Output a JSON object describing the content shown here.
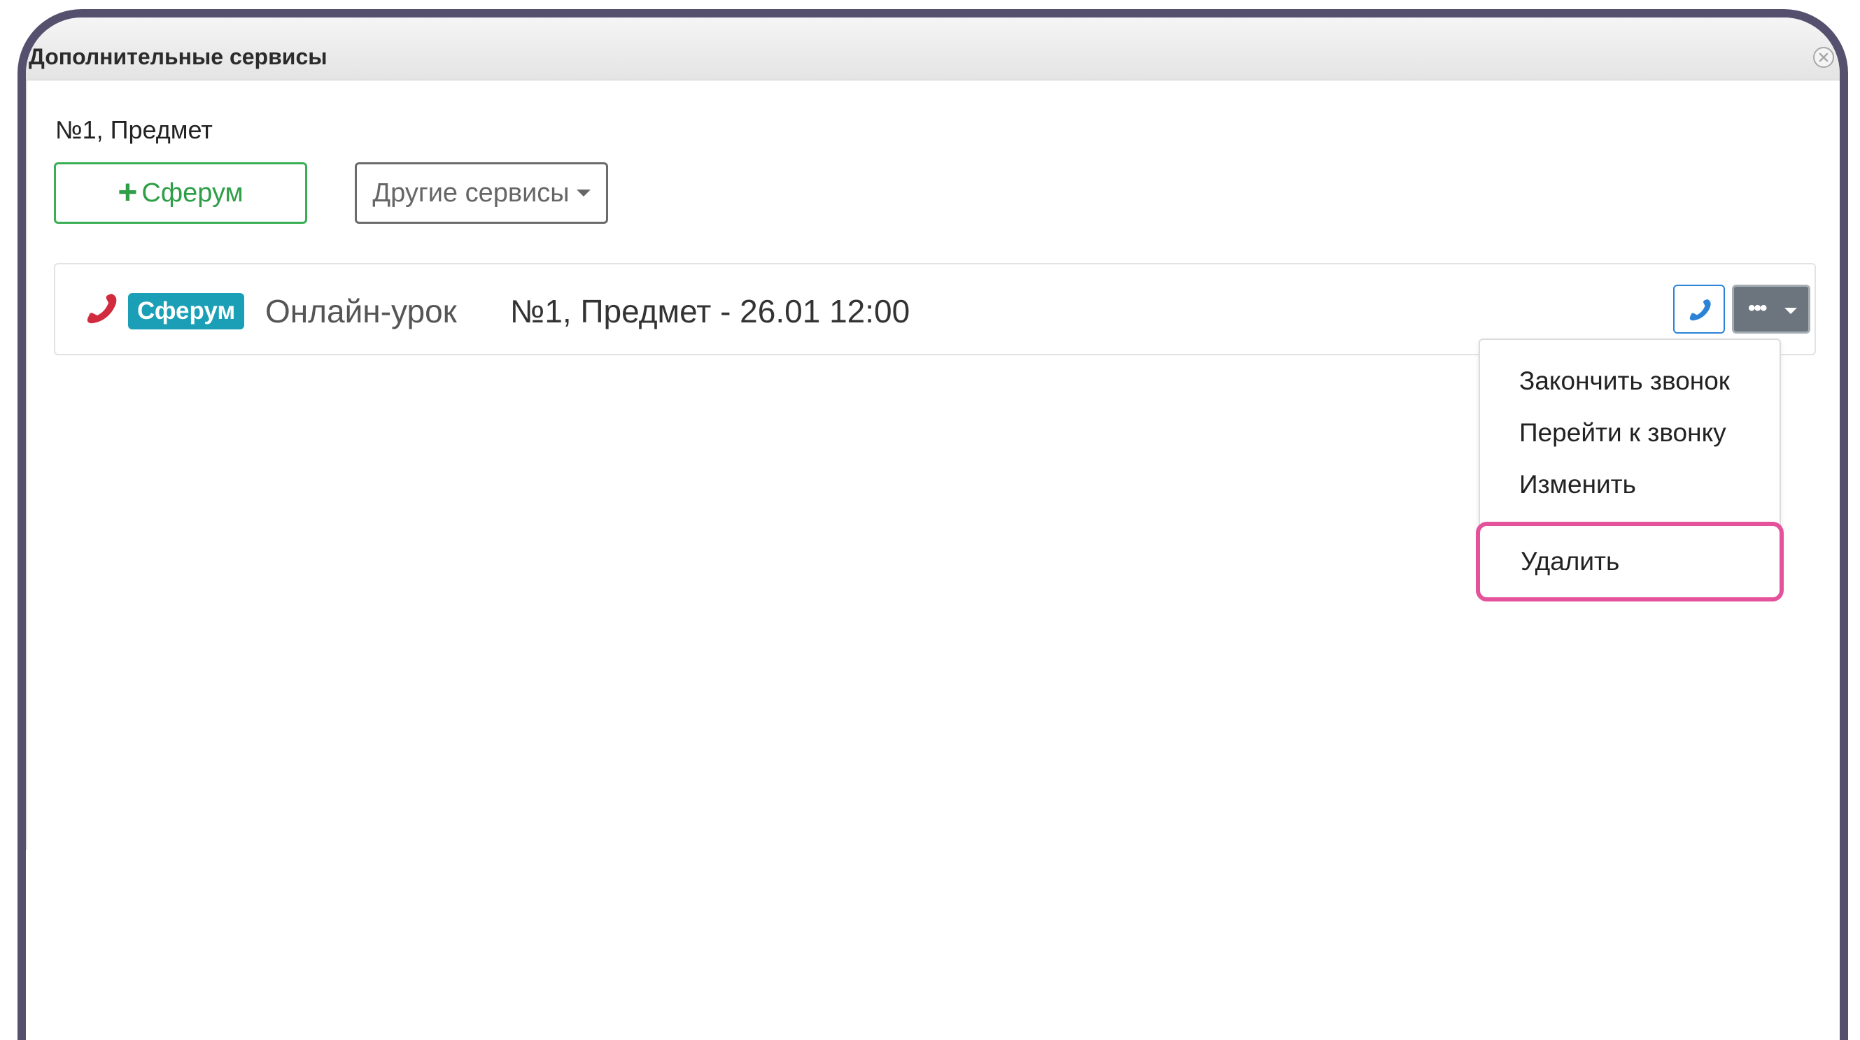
{
  "dialog": {
    "title": "Дополнительные сервисы"
  },
  "subject": "№1, Предмет",
  "buttons": {
    "sferum_plus": "+",
    "sferum_label": "Сферум",
    "other_services": "Другие сервисы"
  },
  "call": {
    "badge": "Сферум",
    "title": "Онлайн-урок",
    "info": "№1, Предмет - 26.01 12:00",
    "more_icon": "•••"
  },
  "menu": {
    "items": [
      "Закончить звонок",
      "Перейти к звонку",
      "Изменить"
    ],
    "delete": "Удалить"
  },
  "colors": {
    "frame": "#55506e",
    "sferum_green": "#3aae55",
    "badge_teal": "#1a9fb6",
    "phone_red": "#d32b3e",
    "phone_blue": "#2b83d6",
    "highlight_pink": "#e3529a"
  }
}
